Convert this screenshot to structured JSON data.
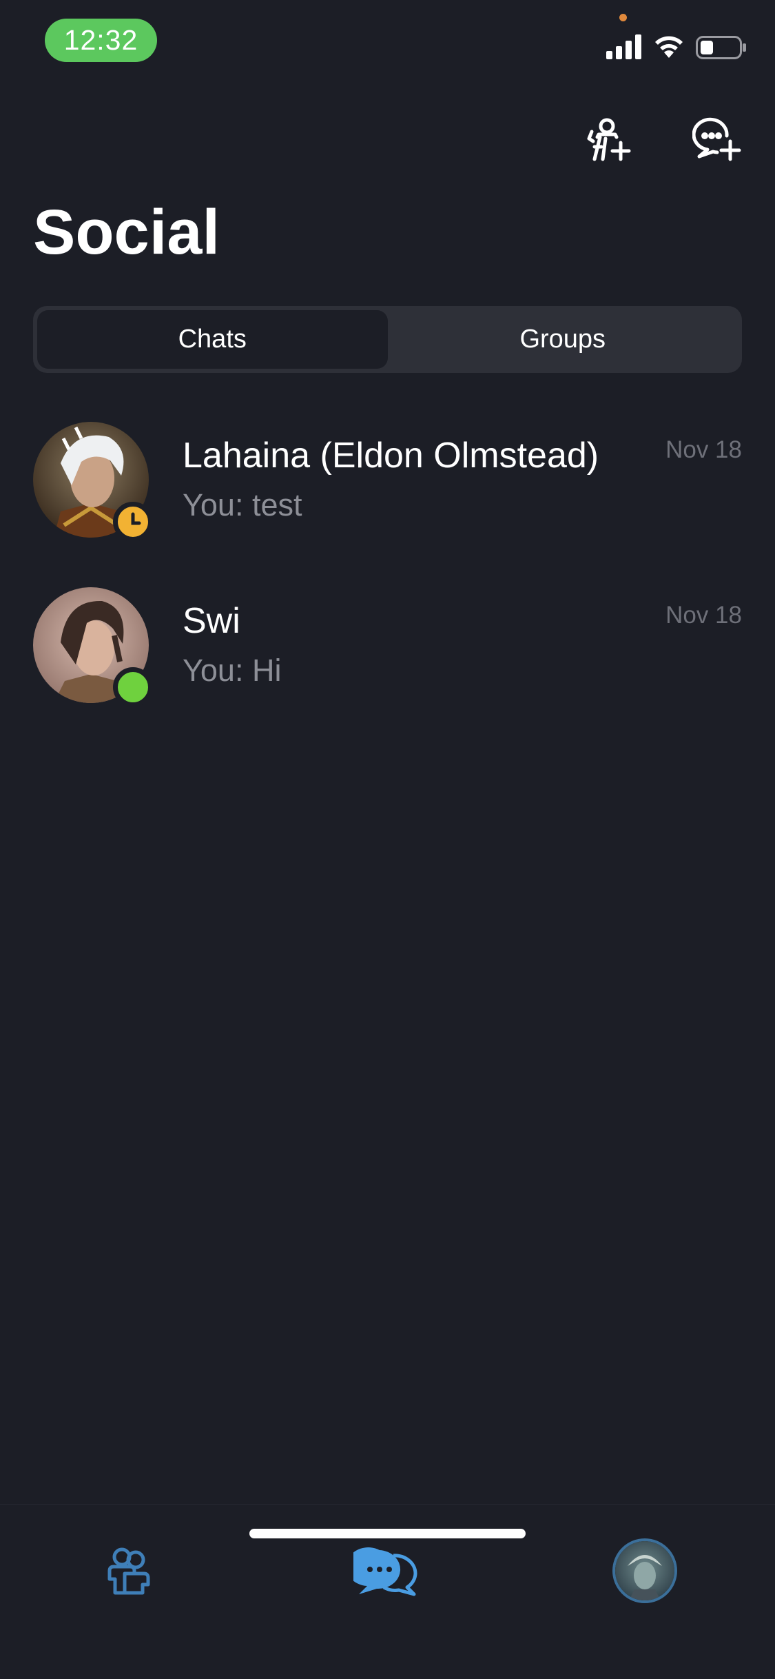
{
  "status_bar": {
    "time": "12:32"
  },
  "header": {
    "title": "Social",
    "add_friend_icon": "add-friend-icon",
    "new_chat_icon": "new-chat-icon"
  },
  "tabs": {
    "items": [
      {
        "label": "Chats",
        "active": true
      },
      {
        "label": "Groups",
        "active": false
      }
    ]
  },
  "chats": [
    {
      "name": "Lahaina (Eldon Olmstead)",
      "preview": "You: test",
      "date": "Nov 18",
      "status": "away",
      "status_color": "#f2b233"
    },
    {
      "name": "Swi",
      "preview": "You: Hi",
      "date": "Nov 18",
      "status": "online",
      "status_color": "#6fd13e"
    }
  ],
  "tab_bar": {
    "items": [
      {
        "icon": "friends-icon",
        "active": false
      },
      {
        "icon": "chats-icon",
        "active": true
      },
      {
        "icon": "profile-avatar",
        "active": false
      }
    ],
    "accent": "#4a9de2"
  }
}
